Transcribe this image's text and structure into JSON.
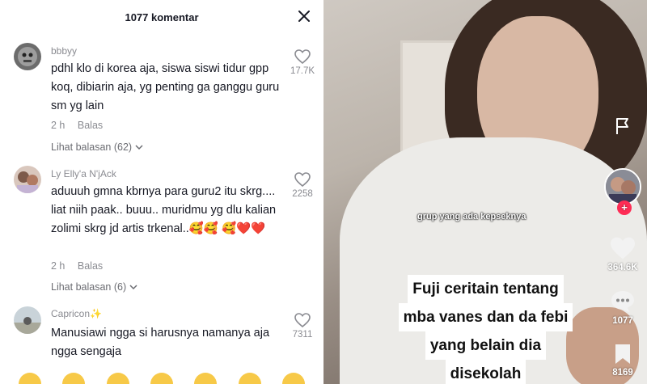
{
  "panel": {
    "title": "1077 komentar"
  },
  "comments": [
    {
      "user": "bbbyy",
      "text": "pdhl klo di korea aja, siswa siswi tidur gpp koq, dibiarin aja, yg penting ga ganggu guru sm yg lain",
      "time": "2 h",
      "reply": "Balas",
      "likes": "17.7K",
      "replies": "Lihat balasan (62)"
    },
    {
      "user": "Ly Elly'a N'jAck",
      "text": "aduuuh gmna kbrnya para guru2 itu skrg.... liat niih paak.. buuu.. muridmu yg dlu kalian zolimi skrg jd artis trkenal..🥰🥰 🥰❤️❤️",
      "time": "2 h",
      "reply": "Balas",
      "likes": "2258",
      "replies": "Lihat balasan (6)"
    },
    {
      "user": "Capricon✨",
      "text": "Manusiawi ngga si harusnya namanya aja ngga sengaja",
      "likes": "7311"
    }
  ],
  "video": {
    "caption_top": "grup yang ada kepseknya",
    "caption_lines": [
      "Fuji ceritain tentang",
      "mba vanes dan da febi",
      "yang belain dia",
      "disekolah"
    ],
    "likes": "364.6K",
    "comments": "1077",
    "saves": "8169"
  },
  "colors": {
    "accent": "#fe2c55",
    "text": "#161823",
    "muted": "#8a8b91"
  },
  "icons": [
    "close-icon",
    "heart-outline-icon",
    "chevron-down-icon",
    "flag-icon",
    "heart-icon",
    "comment-icon",
    "bookmark-icon",
    "plus-icon"
  ]
}
